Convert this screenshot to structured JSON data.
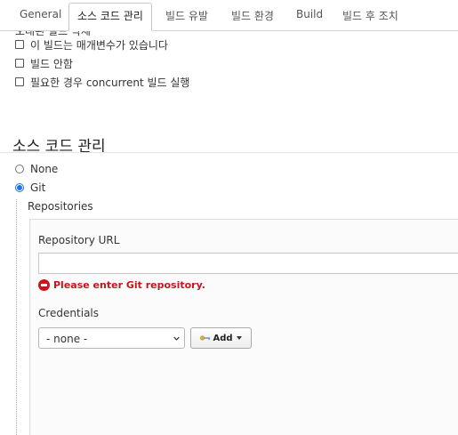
{
  "tabs": [
    {
      "label": "General"
    },
    {
      "label": "소스 코드 관리",
      "active": true
    },
    {
      "label": "빌드 유발"
    },
    {
      "label": "빌드 환경"
    },
    {
      "label": "Build"
    },
    {
      "label": "빌드 후 조치"
    }
  ],
  "options": {
    "partial_label": "오래된 빌드 삭제",
    "items": [
      {
        "label": "이 빌드는 매개변수가 있습니다",
        "checked": false
      },
      {
        "label": "빌드 안함",
        "checked": false
      },
      {
        "label": "필요한 경우 concurrent 빌드 실행",
        "checked": false
      }
    ]
  },
  "scm": {
    "title": "소스 코드 관리",
    "choices": [
      {
        "label": "None",
        "selected": false
      },
      {
        "label": "Git",
        "selected": true
      }
    ],
    "repositories_label": "Repositories",
    "repository_url": {
      "label": "Repository URL",
      "value": "",
      "error": "Please enter Git repository."
    },
    "credentials": {
      "label": "Credentials",
      "selected": "- none -",
      "add_label": "Add"
    }
  },
  "colors": {
    "error": "#c4161c",
    "radio_accent": "#1a73e8"
  }
}
